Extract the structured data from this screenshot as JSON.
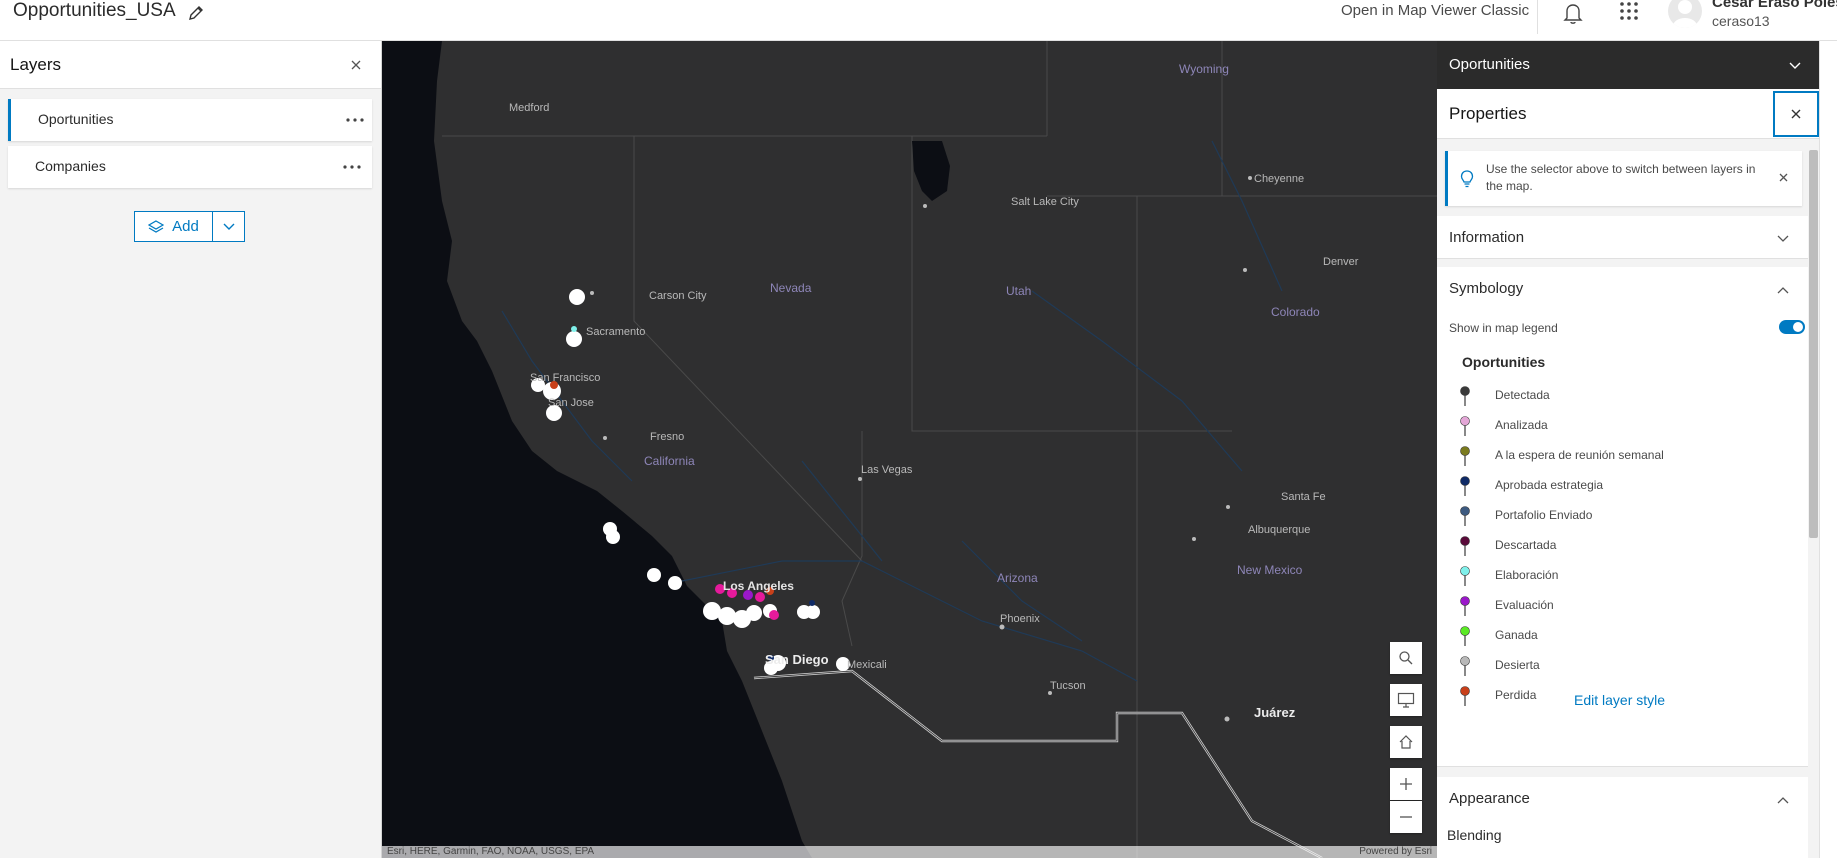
{
  "header": {
    "title": "Opportunities_USA",
    "open_classic": "Open in Map Viewer Classic",
    "user_name": "Cesar Eraso Poles",
    "user_handle": "ceraso13"
  },
  "layers_panel": {
    "title": "Layers",
    "items": [
      {
        "label": "Oportunities"
      },
      {
        "label": "Companies"
      }
    ],
    "add_label": "Add"
  },
  "map": {
    "labels": [
      {
        "text": "Wyoming",
        "kind": "state"
      },
      {
        "text": "Medford",
        "kind": "city"
      },
      {
        "text": "Cheyenne",
        "kind": "city"
      },
      {
        "text": "Salt Lake City",
        "kind": "city"
      },
      {
        "text": "Denver",
        "kind": "city"
      },
      {
        "text": "Carson City",
        "kind": "city"
      },
      {
        "text": "Nevada",
        "kind": "state"
      },
      {
        "text": "Utah",
        "kind": "state"
      },
      {
        "text": "Colorado",
        "kind": "state"
      },
      {
        "text": "Sacramento",
        "kind": "city"
      },
      {
        "text": "San Francisco",
        "kind": "city"
      },
      {
        "text": "San Jose",
        "kind": "city"
      },
      {
        "text": "Fresno",
        "kind": "city"
      },
      {
        "text": "California",
        "kind": "state"
      },
      {
        "text": "Las Vegas",
        "kind": "city"
      },
      {
        "text": "Santa Fe",
        "kind": "city"
      },
      {
        "text": "Albuquerque",
        "kind": "city"
      },
      {
        "text": "New Mexico",
        "kind": "state"
      },
      {
        "text": "Los Angeles",
        "kind": "big"
      },
      {
        "text": "Arizona",
        "kind": "state"
      },
      {
        "text": "Phoenix",
        "kind": "city"
      },
      {
        "text": "San Diego",
        "kind": "bigger"
      },
      {
        "text": "Mexicali",
        "kind": "city"
      },
      {
        "text": "Tucson",
        "kind": "city"
      },
      {
        "text": "Juárez",
        "kind": "bigger"
      }
    ],
    "attribution_left": "Esri, HERE, Garmin, FAO, NOAA, USGS, EPA",
    "attribution_right": "Powered by Esri"
  },
  "properties_panel": {
    "layer_selector": "Oportunities",
    "title": "Properties",
    "notice": "Use the selector above to switch between layers in the map.",
    "information_label": "Information",
    "symbology_label": "Symbology",
    "show_legend_label": "Show in map legend",
    "show_legend_on": true,
    "legend_title": "Oportunities",
    "legend": [
      {
        "label": "Detectada",
        "color": "#3a3a3a"
      },
      {
        "label": "Analizada",
        "color": "#e3a6d6"
      },
      {
        "label": "A la espera de reunión semanal",
        "color": "#7a7a1e"
      },
      {
        "label": "Aprobada estrategia",
        "color": "#0f2a66"
      },
      {
        "label": "Portafolio Enviado",
        "color": "#3d5a80"
      },
      {
        "label": "Descartada",
        "color": "#5a0a3a"
      },
      {
        "label": "Elaboración",
        "color": "#7ff0ea"
      },
      {
        "label": "Evaluación",
        "color": "#9a18c9"
      },
      {
        "label": "Ganada",
        "color": "#5bea25"
      },
      {
        "label": "Desierta",
        "color": "#b8b8b8"
      },
      {
        "label": "Perdida",
        "color": "#c8401a"
      }
    ],
    "edit_style_label": "Edit layer style",
    "appearance_label": "Appearance",
    "blending_label": "Blending"
  }
}
